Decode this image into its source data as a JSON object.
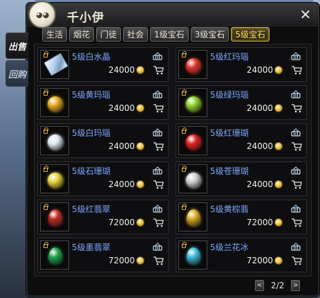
{
  "window": {
    "title": "千小伊",
    "close_label": "✕"
  },
  "side_tabs": [
    {
      "label": "出售",
      "active": true
    },
    {
      "label": "回购",
      "active": false
    }
  ],
  "category_tabs": [
    {
      "label": "生活",
      "active": false
    },
    {
      "label": "烟花",
      "active": false
    },
    {
      "label": "门徒",
      "active": false
    },
    {
      "label": "社会",
      "active": false
    },
    {
      "label": "1级宝石",
      "active": false
    },
    {
      "label": "3级宝石",
      "active": false
    },
    {
      "label": "5级宝石",
      "active": true
    }
  ],
  "items": [
    {
      "name": "5级白水晶",
      "price": "24000",
      "icon": "white-crystal-icon",
      "color": "#cfe2f5",
      "locked": true
    },
    {
      "name": "5级红玛瑙",
      "price": "24000",
      "icon": "red-agate-icon",
      "color": "#e0322a",
      "locked": true
    },
    {
      "name": "5级黄玛瑙",
      "price": "24000",
      "icon": "yellow-agate-icon",
      "color": "#e6a820",
      "locked": true
    },
    {
      "name": "5级绿玛瑙",
      "price": "24000",
      "icon": "green-agate-icon",
      "color": "#8fcf2e",
      "locked": true
    },
    {
      "name": "5级白玛瑙",
      "price": "24000",
      "icon": "white-agate-icon",
      "color": "#dfe8f2",
      "locked": true
    },
    {
      "name": "5级红珊瑚",
      "price": "24000",
      "icon": "red-coral-icon",
      "color": "#e0201e",
      "locked": true
    },
    {
      "name": "5级石珊瑚",
      "price": "24000",
      "icon": "stone-coral-icon",
      "color": "#e8d43a",
      "locked": true
    },
    {
      "name": "5级苍珊瑚",
      "price": "24000",
      "icon": "gray-coral-icon",
      "color": "#cfcfcf",
      "locked": true
    },
    {
      "name": "5级红翡翠",
      "price": "72000",
      "icon": "red-jade-icon",
      "color": "#c02a22",
      "locked": true
    },
    {
      "name": "5级黄棕翡",
      "price": "72000",
      "icon": "yellow-jade-icon",
      "color": "#d6a81e",
      "locked": true
    },
    {
      "name": "5级墨翡翠",
      "price": "72000",
      "icon": "ink-jade-icon",
      "color": "#1ea04a",
      "locked": true
    },
    {
      "name": "5级兰花冰",
      "price": "72000",
      "icon": "orchid-ice-icon",
      "color": "#3ab8d8",
      "locked": true
    }
  ],
  "pager": {
    "prev_label": "<",
    "next_label": ">",
    "page_text": "2/2"
  }
}
